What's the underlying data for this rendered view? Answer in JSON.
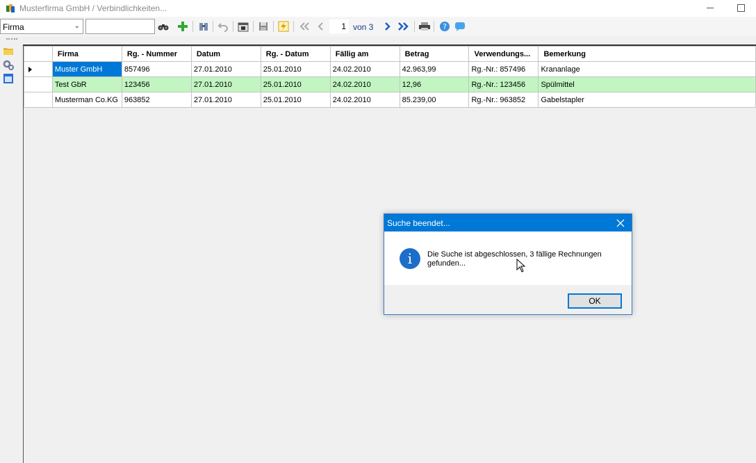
{
  "window": {
    "title": "Musterfirma GmbH / Verbindlichkeiten..."
  },
  "toolbar": {
    "field_select_value": "Firma",
    "search_value": "",
    "page_current": "1",
    "page_of": "von 3"
  },
  "grid": {
    "columns": [
      "Firma",
      "Rg. - Nummer",
      "Datum",
      "Rg. - Datum",
      "Fällig am",
      "Betrag",
      "Verwendungs...",
      "Bemerkung"
    ],
    "rows": [
      [
        "Muster GmbH",
        "857496",
        "27.01.2010",
        "25.01.2010",
        "24.02.2010",
        "42.963,99",
        "Rg.-Nr.: 857496",
        "Krananlage"
      ],
      [
        "Test GbR",
        "123456",
        "27.01.2010",
        "25.01.2010",
        "24.02.2010",
        "12,96",
        "Rg.-Nr.: 123456",
        "Spülmittel"
      ],
      [
        "Musterman Co.KG",
        "963852",
        "27.01.2010",
        "25.01.2010",
        "24.02.2010",
        "85.239,00",
        "Rg.-Nr.: 963852",
        "Gabelstapler"
      ]
    ]
  },
  "dialog": {
    "title": "Suche beendet...",
    "message": "Die Suche ist abgeschlossen, 3 fällige Rechnungen gefunden...",
    "ok_label": "OK"
  },
  "colors": {
    "accent": "#0078d7",
    "highlight_row": "#c2f5c2"
  }
}
